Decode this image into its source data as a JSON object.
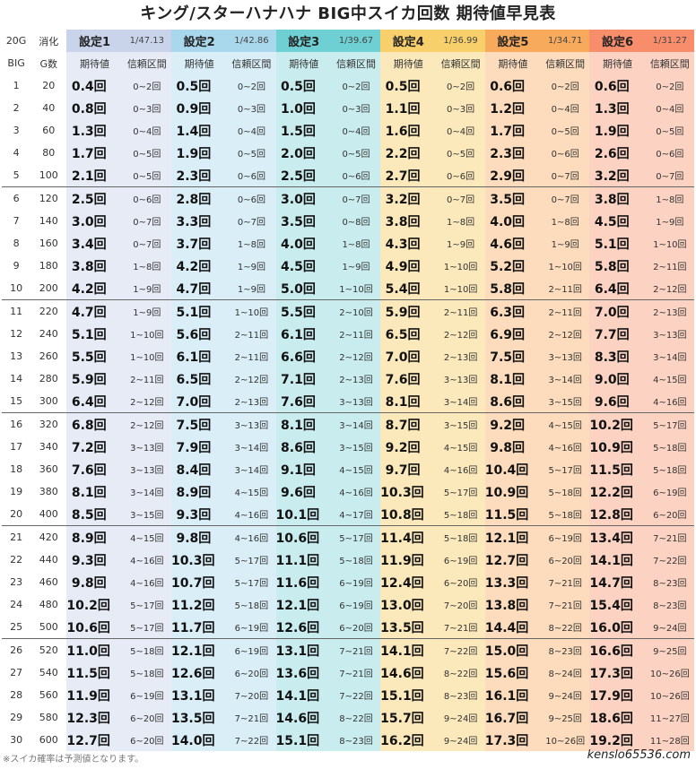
{
  "title": "キング/スターハナハナ BIG中スイカ回数 期待値早見表",
  "header": {
    "col1_top": "20G",
    "col2_top": "消化",
    "col1_bottom": "BIG",
    "col2_bottom": "G数",
    "expect_label": "期待値",
    "range_label": "信頼区間",
    "settings": [
      {
        "label": "設定1",
        "prob": "1/47.13"
      },
      {
        "label": "設定2",
        "prob": "1/42.86"
      },
      {
        "label": "設定3",
        "prob": "1/39.67"
      },
      {
        "label": "設定4",
        "prob": "1/36.99"
      },
      {
        "label": "設定5",
        "prob": "1/34.71"
      },
      {
        "label": "設定6",
        "prob": "1/31.27"
      }
    ]
  },
  "colors": {
    "set1_head": "#c9d4ea",
    "set1_cell": "#e6ebf6",
    "set2_head": "#a9d8ec",
    "set2_cell": "#d9eef7",
    "set3_head": "#6fd0d3",
    "set3_cell": "#c9ecee",
    "set4_head": "#f7cf6b",
    "set4_cell": "#fbe9bb",
    "set5_head": "#f7a95c",
    "set5_cell": "#fcdcbc",
    "set6_head": "#f88d6c",
    "set6_cell": "#fcd3c3"
  },
  "rows": [
    {
      "big": "1",
      "g": "20",
      "v": [
        [
          "0.4回",
          "0~2回"
        ],
        [
          "0.5回",
          "0~2回"
        ],
        [
          "0.5回",
          "0~2回"
        ],
        [
          "0.5回",
          "0~2回"
        ],
        [
          "0.6回",
          "0~2回"
        ],
        [
          "0.6回",
          "0~2回"
        ]
      ]
    },
    {
      "big": "2",
      "g": "40",
      "v": [
        [
          "0.8回",
          "0~3回"
        ],
        [
          "0.9回",
          "0~3回"
        ],
        [
          "1.0回",
          "0~3回"
        ],
        [
          "1.1回",
          "0~3回"
        ],
        [
          "1.2回",
          "0~4回"
        ],
        [
          "1.3回",
          "0~4回"
        ]
      ]
    },
    {
      "big": "3",
      "g": "60",
      "v": [
        [
          "1.3回",
          "0~4回"
        ],
        [
          "1.4回",
          "0~4回"
        ],
        [
          "1.5回",
          "0~4回"
        ],
        [
          "1.6回",
          "0~4回"
        ],
        [
          "1.7回",
          "0~5回"
        ],
        [
          "1.9回",
          "0~5回"
        ]
      ]
    },
    {
      "big": "4",
      "g": "80",
      "v": [
        [
          "1.7回",
          "0~5回"
        ],
        [
          "1.9回",
          "0~5回"
        ],
        [
          "2.0回",
          "0~5回"
        ],
        [
          "2.2回",
          "0~5回"
        ],
        [
          "2.3回",
          "0~6回"
        ],
        [
          "2.6回",
          "0~6回"
        ]
      ]
    },
    {
      "big": "5",
      "g": "100",
      "v": [
        [
          "2.1回",
          "0~5回"
        ],
        [
          "2.3回",
          "0~6回"
        ],
        [
          "2.5回",
          "0~6回"
        ],
        [
          "2.7回",
          "0~6回"
        ],
        [
          "2.9回",
          "0~7回"
        ],
        [
          "3.2回",
          "0~7回"
        ]
      ]
    },
    {
      "big": "6",
      "g": "120",
      "v": [
        [
          "2.5回",
          "0~6回"
        ],
        [
          "2.8回",
          "0~6回"
        ],
        [
          "3.0回",
          "0~7回"
        ],
        [
          "3.2回",
          "0~7回"
        ],
        [
          "3.5回",
          "0~7回"
        ],
        [
          "3.8回",
          "1~8回"
        ]
      ]
    },
    {
      "big": "7",
      "g": "140",
      "v": [
        [
          "3.0回",
          "0~7回"
        ],
        [
          "3.3回",
          "0~7回"
        ],
        [
          "3.5回",
          "0~8回"
        ],
        [
          "3.8回",
          "1~8回"
        ],
        [
          "4.0回",
          "1~8回"
        ],
        [
          "4.5回",
          "1~9回"
        ]
      ]
    },
    {
      "big": "8",
      "g": "160",
      "v": [
        [
          "3.4回",
          "0~7回"
        ],
        [
          "3.7回",
          "1~8回"
        ],
        [
          "4.0回",
          "1~8回"
        ],
        [
          "4.3回",
          "1~9回"
        ],
        [
          "4.6回",
          "1~9回"
        ],
        [
          "5.1回",
          "1~10回"
        ]
      ]
    },
    {
      "big": "9",
      "g": "180",
      "v": [
        [
          "3.8回",
          "1~8回"
        ],
        [
          "4.2回",
          "1~9回"
        ],
        [
          "4.5回",
          "1~9回"
        ],
        [
          "4.9回",
          "1~10回"
        ],
        [
          "5.2回",
          "1~10回"
        ],
        [
          "5.8回",
          "2~11回"
        ]
      ]
    },
    {
      "big": "10",
      "g": "200",
      "v": [
        [
          "4.2回",
          "1~9回"
        ],
        [
          "4.7回",
          "1~9回"
        ],
        [
          "5.0回",
          "1~10回"
        ],
        [
          "5.4回",
          "1~10回"
        ],
        [
          "5.8回",
          "2~11回"
        ],
        [
          "6.4回",
          "2~12回"
        ]
      ]
    },
    {
      "big": "11",
      "g": "220",
      "v": [
        [
          "4.7回",
          "1~9回"
        ],
        [
          "5.1回",
          "1~10回"
        ],
        [
          "5.5回",
          "2~10回"
        ],
        [
          "5.9回",
          "2~11回"
        ],
        [
          "6.3回",
          "2~11回"
        ],
        [
          "7.0回",
          "2~13回"
        ]
      ]
    },
    {
      "big": "12",
      "g": "240",
      "v": [
        [
          "5.1回",
          "1~10回"
        ],
        [
          "5.6回",
          "2~11回"
        ],
        [
          "6.1回",
          "2~11回"
        ],
        [
          "6.5回",
          "2~12回"
        ],
        [
          "6.9回",
          "2~12回"
        ],
        [
          "7.7回",
          "3~13回"
        ]
      ]
    },
    {
      "big": "13",
      "g": "260",
      "v": [
        [
          "5.5回",
          "1~10回"
        ],
        [
          "6.1回",
          "2~11回"
        ],
        [
          "6.6回",
          "2~12回"
        ],
        [
          "7.0回",
          "2~13回"
        ],
        [
          "7.5回",
          "3~13回"
        ],
        [
          "8.3回",
          "3~14回"
        ]
      ]
    },
    {
      "big": "14",
      "g": "280",
      "v": [
        [
          "5.9回",
          "2~11回"
        ],
        [
          "6.5回",
          "2~12回"
        ],
        [
          "7.1回",
          "2~13回"
        ],
        [
          "7.6回",
          "3~13回"
        ],
        [
          "8.1回",
          "3~14回"
        ],
        [
          "9.0回",
          "4~15回"
        ]
      ]
    },
    {
      "big": "15",
      "g": "300",
      "v": [
        [
          "6.4回",
          "2~12回"
        ],
        [
          "7.0回",
          "2~13回"
        ],
        [
          "7.6回",
          "3~13回"
        ],
        [
          "8.1回",
          "3~14回"
        ],
        [
          "8.6回",
          "3~15回"
        ],
        [
          "9.6回",
          "4~16回"
        ]
      ]
    },
    {
      "big": "16",
      "g": "320",
      "v": [
        [
          "6.8回",
          "2~12回"
        ],
        [
          "7.5回",
          "3~13回"
        ],
        [
          "8.1回",
          "3~14回"
        ],
        [
          "8.7回",
          "3~15回"
        ],
        [
          "9.2回",
          "4~15回"
        ],
        [
          "10.2回",
          "5~17回"
        ]
      ]
    },
    {
      "big": "17",
      "g": "340",
      "v": [
        [
          "7.2回",
          "3~13回"
        ],
        [
          "7.9回",
          "3~14回"
        ],
        [
          "8.6回",
          "3~15回"
        ],
        [
          "9.2回",
          "4~15回"
        ],
        [
          "9.8回",
          "4~16回"
        ],
        [
          "10.9回",
          "5~18回"
        ]
      ]
    },
    {
      "big": "18",
      "g": "360",
      "v": [
        [
          "7.6回",
          "3~13回"
        ],
        [
          "8.4回",
          "3~14回"
        ],
        [
          "9.1回",
          "4~15回"
        ],
        [
          "9.7回",
          "4~16回"
        ],
        [
          "10.4回",
          "5~17回"
        ],
        [
          "11.5回",
          "5~18回"
        ]
      ]
    },
    {
      "big": "19",
      "g": "380",
      "v": [
        [
          "8.1回",
          "3~14回"
        ],
        [
          "8.9回",
          "4~15回"
        ],
        [
          "9.6回",
          "4~16回"
        ],
        [
          "10.3回",
          "5~17回"
        ],
        [
          "10.9回",
          "5~18回"
        ],
        [
          "12.2回",
          "6~19回"
        ]
      ]
    },
    {
      "big": "20",
      "g": "400",
      "v": [
        [
          "8.5回",
          "3~15回"
        ],
        [
          "9.3回",
          "4~16回"
        ],
        [
          "10.1回",
          "4~17回"
        ],
        [
          "10.8回",
          "5~18回"
        ],
        [
          "11.5回",
          "5~18回"
        ],
        [
          "12.8回",
          "6~20回"
        ]
      ]
    },
    {
      "big": "21",
      "g": "420",
      "v": [
        [
          "8.9回",
          "4~15回"
        ],
        [
          "9.8回",
          "4~16回"
        ],
        [
          "10.6回",
          "5~17回"
        ],
        [
          "11.4回",
          "5~18回"
        ],
        [
          "12.1回",
          "6~19回"
        ],
        [
          "13.4回",
          "7~21回"
        ]
      ]
    },
    {
      "big": "22",
      "g": "440",
      "v": [
        [
          "9.3回",
          "4~16回"
        ],
        [
          "10.3回",
          "5~17回"
        ],
        [
          "11.1回",
          "5~18回"
        ],
        [
          "11.9回",
          "6~19回"
        ],
        [
          "12.7回",
          "6~20回"
        ],
        [
          "14.1回",
          "7~22回"
        ]
      ]
    },
    {
      "big": "23",
      "g": "460",
      "v": [
        [
          "9.8回",
          "4~16回"
        ],
        [
          "10.7回",
          "5~17回"
        ],
        [
          "11.6回",
          "6~19回"
        ],
        [
          "12.4回",
          "6~20回"
        ],
        [
          "13.3回",
          "7~21回"
        ],
        [
          "14.7回",
          "8~23回"
        ]
      ]
    },
    {
      "big": "24",
      "g": "480",
      "v": [
        [
          "10.2回",
          "5~17回"
        ],
        [
          "11.2回",
          "5~18回"
        ],
        [
          "12.1回",
          "6~19回"
        ],
        [
          "13.0回",
          "7~20回"
        ],
        [
          "13.8回",
          "7~21回"
        ],
        [
          "15.4回",
          "8~23回"
        ]
      ]
    },
    {
      "big": "25",
      "g": "500",
      "v": [
        [
          "10.6回",
          "5~17回"
        ],
        [
          "11.7回",
          "6~19回"
        ],
        [
          "12.6回",
          "6~20回"
        ],
        [
          "13.5回",
          "7~21回"
        ],
        [
          "14.4回",
          "8~22回"
        ],
        [
          "16.0回",
          "9~24回"
        ]
      ]
    },
    {
      "big": "26",
      "g": "520",
      "v": [
        [
          "11.0回",
          "5~18回"
        ],
        [
          "12.1回",
          "6~19回"
        ],
        [
          "13.1回",
          "7~21回"
        ],
        [
          "14.1回",
          "7~22回"
        ],
        [
          "15.0回",
          "8~23回"
        ],
        [
          "16.6回",
          "9~25回"
        ]
      ]
    },
    {
      "big": "27",
      "g": "540",
      "v": [
        [
          "11.5回",
          "5~18回"
        ],
        [
          "12.6回",
          "6~20回"
        ],
        [
          "13.6回",
          "7~21回"
        ],
        [
          "14.6回",
          "8~22回"
        ],
        [
          "15.6回",
          "8~24回"
        ],
        [
          "17.3回",
          "10~26回"
        ]
      ]
    },
    {
      "big": "28",
      "g": "560",
      "v": [
        [
          "11.9回",
          "6~19回"
        ],
        [
          "13.1回",
          "7~20回"
        ],
        [
          "14.1回",
          "7~22回"
        ],
        [
          "15.1回",
          "8~23回"
        ],
        [
          "16.1回",
          "9~24回"
        ],
        [
          "17.9回",
          "10~26回"
        ]
      ]
    },
    {
      "big": "29",
      "g": "580",
      "v": [
        [
          "12.3回",
          "6~20回"
        ],
        [
          "13.5回",
          "7~21回"
        ],
        [
          "14.6回",
          "8~22回"
        ],
        [
          "15.7回",
          "9~24回"
        ],
        [
          "16.7回",
          "9~25回"
        ],
        [
          "18.6回",
          "11~27回"
        ]
      ]
    },
    {
      "big": "30",
      "g": "600",
      "v": [
        [
          "12.7回",
          "6~20回"
        ],
        [
          "14.0回",
          "7~22回"
        ],
        [
          "15.1回",
          "8~23回"
        ],
        [
          "16.2回",
          "9~24回"
        ],
        [
          "17.3回",
          "10~26回"
        ],
        [
          "19.2回",
          "11~28回"
        ]
      ]
    }
  ],
  "footnote": "※スイカ確率は予測値となります。",
  "site": "kenslo65536.com"
}
